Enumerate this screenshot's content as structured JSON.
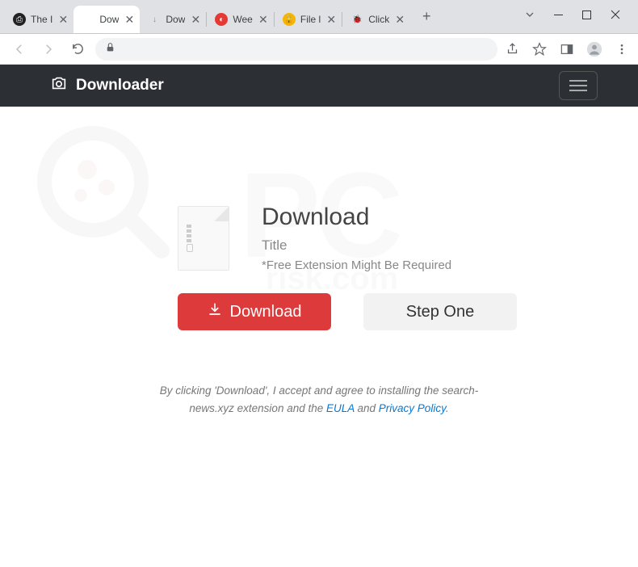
{
  "window": {
    "controls": [
      "minimize",
      "maximize",
      "close"
    ]
  },
  "tabs": [
    {
      "title": "The I",
      "active": false,
      "favicon_bg": "#222",
      "favicon_fg": "#fff",
      "favicon_char": "⎙"
    },
    {
      "title": "Dow",
      "active": true,
      "favicon_bg": "",
      "favicon_fg": "#888",
      "favicon_char": ""
    },
    {
      "title": "Dow",
      "active": false,
      "favicon_bg": "",
      "favicon_fg": "#888",
      "favicon_char": "↓"
    },
    {
      "title": "Wee",
      "active": false,
      "favicon_bg": "#e53935",
      "favicon_fg": "#fff",
      "favicon_char": "◐"
    },
    {
      "title": "File l",
      "active": false,
      "favicon_bg": "#f7b500",
      "favicon_fg": "#000",
      "favicon_char": "🔒"
    },
    {
      "title": "Click",
      "active": false,
      "favicon_bg": "",
      "favicon_fg": "#d33",
      "favicon_char": "🐞"
    }
  ],
  "header": {
    "brand": "Downloader"
  },
  "main": {
    "heading": "Download",
    "subtitle": "Title",
    "note": "*Free Extension Might Be Required"
  },
  "buttons": {
    "download": "Download",
    "step_one": "Step One"
  },
  "disclaimer": {
    "pre": "By clicking 'Download', I accept and agree to installing the search-news.xyz extension and the ",
    "eula": "EULA",
    "mid": " and ",
    "privacy": "Privacy Policy",
    "post": "."
  }
}
